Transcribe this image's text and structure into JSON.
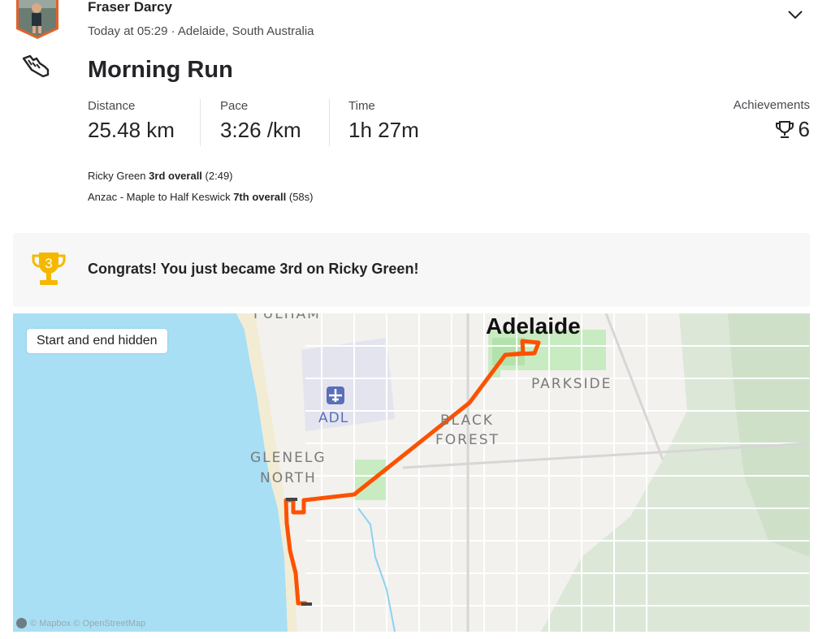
{
  "athlete": {
    "name": "Fraser Darcy",
    "meta": "Today at 05:29 · Adelaide, South Australia"
  },
  "activity": {
    "icon": "running-shoe-icon",
    "title": "Morning Run",
    "stats": [
      {
        "label": "Distance",
        "value": "25.48 km"
      },
      {
        "label": "Pace",
        "value": "3:26 /km"
      },
      {
        "label": "Time",
        "value": "1h 27m"
      }
    ],
    "achievements": {
      "label": "Achievements",
      "value": "6",
      "icon": "trophy-icon"
    },
    "segments": [
      {
        "name": "Ricky Green",
        "rank": "3rd overall",
        "time": "(2:49)"
      },
      {
        "name": "Anzac - Maple to Half Keswick",
        "rank": "7th overall",
        "time": "(58s)"
      }
    ]
  },
  "banner": {
    "badge": "3",
    "message": "Congrats! You just became 3rd on Ricky Green!",
    "color": "#f5b800"
  },
  "map": {
    "pill": "Start and end hidden",
    "labels": {
      "fulham": "FULHAM",
      "adelaide": "Adelaide",
      "parkside": "PARKSIDE",
      "airport": "ADL",
      "black": "BLACK",
      "forest": "FOREST",
      "glenelg": "GLENELG",
      "north": "NORTH"
    },
    "attribution": "© Mapbox © OpenStreetMap",
    "route_color": "#fc5200",
    "water_color": "#a8dff5"
  }
}
